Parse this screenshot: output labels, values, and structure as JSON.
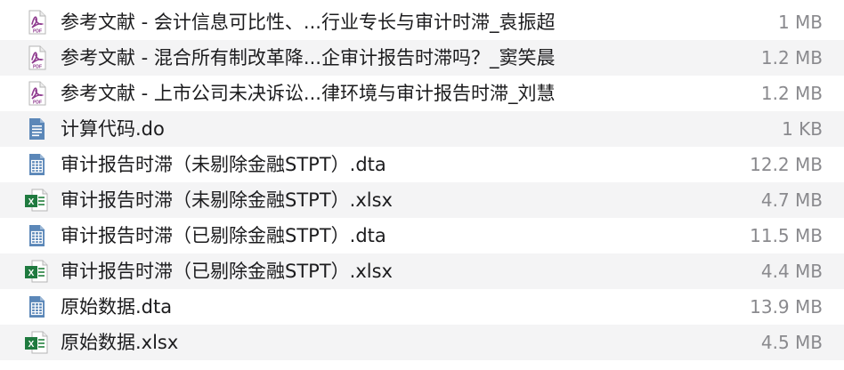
{
  "files": [
    {
      "name": "参考文献 - 会计信息可比性、...行业专长与审计时滞_袁振超",
      "size": "1 MB",
      "icon": "pdf-icon"
    },
    {
      "name": "参考文献 - 混合所有制改革降...企审计报告时滞吗？_窦笑晨",
      "size": "1.2 MB",
      "icon": "pdf-icon"
    },
    {
      "name": "参考文献 - 上市公司未决诉讼...律环境与审计报告时滞_刘慧",
      "size": "1.2 MB",
      "icon": "pdf-icon"
    },
    {
      "name": "计算代码.do",
      "size": "1 KB",
      "icon": "text-document-icon"
    },
    {
      "name": "审计报告时滞（未剔除金融STPT）.dta",
      "size": "12.2 MB",
      "icon": "stata-data-icon"
    },
    {
      "name": "审计报告时滞（未剔除金融STPT）.xlsx",
      "size": "4.7 MB",
      "icon": "excel-icon"
    },
    {
      "name": "审计报告时滞（已剔除金融STPT）.dta",
      "size": "11.5 MB",
      "icon": "stata-data-icon"
    },
    {
      "name": "审计报告时滞（已剔除金融STPT）.xlsx",
      "size": "4.4 MB",
      "icon": "excel-icon"
    },
    {
      "name": "原始数据.dta",
      "size": "13.9 MB",
      "icon": "stata-data-icon"
    },
    {
      "name": "原始数据.xlsx",
      "size": "4.5 MB",
      "icon": "excel-icon"
    }
  ],
  "colors": {
    "pdf_accent": "#8e3a8e",
    "doc_accent": "#5b87b8",
    "excel_accent": "#1f7a3f",
    "row_alt": "#f4f4f5",
    "name_text": "#1c1c1e",
    "size_text": "#8a8a8e"
  }
}
